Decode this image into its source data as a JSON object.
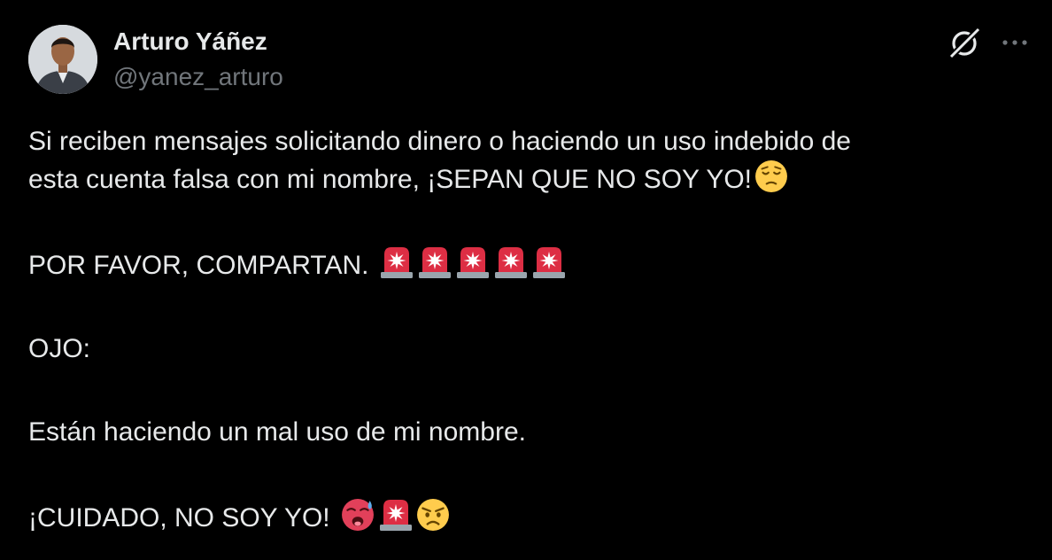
{
  "author": {
    "display_name": "Arturo Yáñez",
    "handle": "@yanez_arturo"
  },
  "icons": {
    "grok": "grok-icon",
    "more": "more-options-icon"
  },
  "body": {
    "line1": "Si reciben mensajes solicitando dinero o haciendo un uso indebido de",
    "line2": "esta cuenta falsa con mi nombre, ¡SEPAN QUE NO SOY YO!",
    "line3": "POR FAVOR, COMPARTAN.",
    "line4": "OJO:",
    "line5": "Están haciendo un mal uso de mi nombre.",
    "line6": "¡CUIDADO, NO SOY YO!"
  },
  "emojis": {
    "line2": [
      "pensive-face"
    ],
    "line3": [
      "police-light",
      "police-light",
      "police-light",
      "police-light",
      "police-light"
    ],
    "line6": [
      "hot-face-sweat",
      "police-light",
      "angry-face"
    ]
  },
  "colors": {
    "background": "#000000",
    "text": "#e7e9ea",
    "secondary": "#71767b"
  }
}
